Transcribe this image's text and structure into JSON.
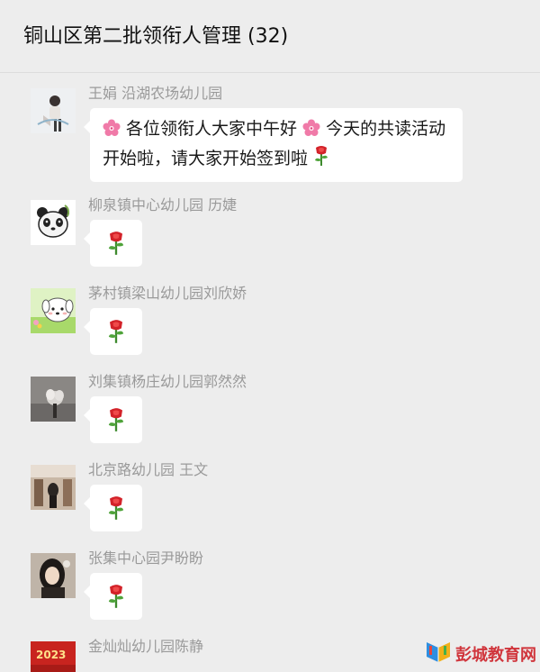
{
  "header": {
    "title": "铜山区第二批领衔人管理 (32)"
  },
  "messages": [
    {
      "sender": "王娟 沿湖农场幼儿园",
      "text_parts": [
        "各位领衔人大家中午好",
        "今天的共读活动开始啦，请大家开始签到啦"
      ],
      "avatar_icon": "person-photo-avatar"
    },
    {
      "sender": "柳泉镇中心幼儿园 历婕",
      "emoji": "rose",
      "avatar_icon": "panda-avatar"
    },
    {
      "sender": "茅村镇梁山幼儿园刘欣娇",
      "emoji": "rose",
      "avatar_icon": "cartoon-dog-avatar"
    },
    {
      "sender": "刘集镇杨庄幼儿园郭然然",
      "emoji": "rose",
      "avatar_icon": "flower-photo-avatar"
    },
    {
      "sender": "北京路幼儿园 王文",
      "emoji": "rose",
      "avatar_icon": "room-photo-avatar"
    },
    {
      "sender": "张集中心园尹盼盼",
      "emoji": "rose",
      "avatar_icon": "girl-photo-avatar"
    },
    {
      "sender": "金灿灿幼儿园陈静",
      "avatar_icon": "red-2023-avatar",
      "avatar_text": "2023"
    }
  ],
  "watermark": {
    "text": "彭城教育网",
    "icon": "book-logo-icon"
  },
  "colors": {
    "background": "#ededed",
    "bubble": "#ffffff",
    "sender_text": "#9a9a9a",
    "watermark": "#d0353c"
  }
}
